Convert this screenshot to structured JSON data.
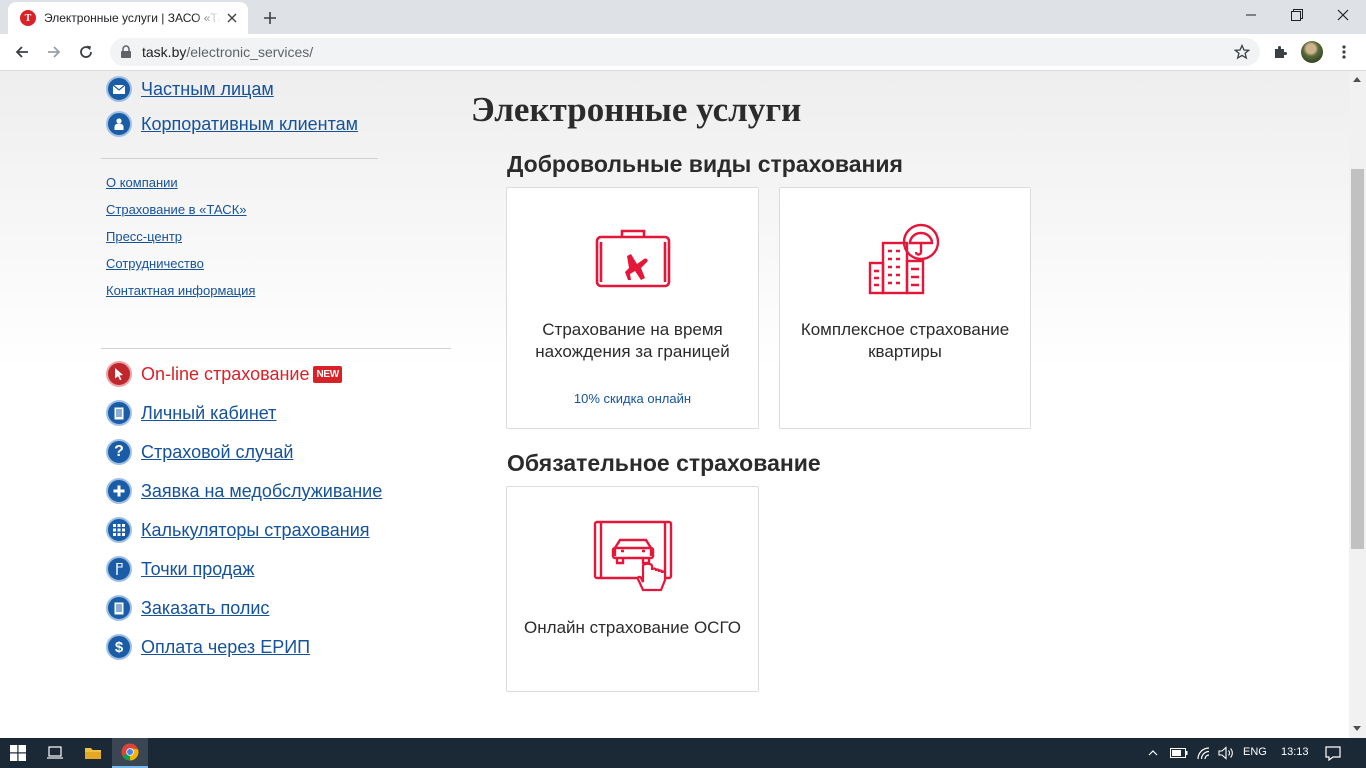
{
  "browser": {
    "tab_title": "Электронные услуги | ЗАСО «ТАСК»",
    "url_host": "task.by",
    "url_path": "/electronic_services/"
  },
  "sidebar": {
    "top_items": [
      {
        "label": "Частным лицам",
        "icon": "envelope-icon"
      },
      {
        "label": "Корпоративным клиентам",
        "icon": "person-icon"
      }
    ],
    "links": [
      "О компании",
      "Страхование в «ТАСК»",
      "Пресс-центр",
      "Сотрудничество",
      "Контактная информация"
    ],
    "online": {
      "label": "On-line страхование",
      "badge": "NEW",
      "icon": "cursor-icon"
    },
    "services": [
      {
        "label": "Личный кабинет",
        "icon": "document-icon"
      },
      {
        "label": "Страховой случай",
        "icon": "question-icon"
      },
      {
        "label": "Заявка на медобслуживание",
        "icon": "plus-icon"
      },
      {
        "label": "Калькуляторы страхования",
        "icon": "calculator-icon"
      },
      {
        "label": "Точки продаж",
        "icon": "flag-icon"
      },
      {
        "label": "Заказать полис",
        "icon": "document-icon"
      },
      {
        "label": "Оплата через ЕРИП",
        "icon": "dollar-icon"
      }
    ]
  },
  "main": {
    "title": "Электронные услуги",
    "voluntary": {
      "title": "Добровольные виды страхования",
      "cards": [
        {
          "label": "Страхование на время нахождения за границей",
          "sub": "10% скидка онлайн",
          "icon": "suitcase-plane-icon"
        },
        {
          "label": "Комплексное страхование квартиры",
          "icon": "building-umbrella-icon"
        }
      ]
    },
    "mandatory": {
      "title": "Обязательное страхование",
      "cards": [
        {
          "label": "Онлайн страхование ОСГО",
          "icon": "car-click-icon"
        }
      ]
    }
  },
  "taskbar": {
    "lang": "ENG",
    "time": "13:13"
  },
  "colors": {
    "brand_red": "#d92228",
    "link_blue": "#15529c",
    "icon_blue": "#1a5ca6"
  }
}
